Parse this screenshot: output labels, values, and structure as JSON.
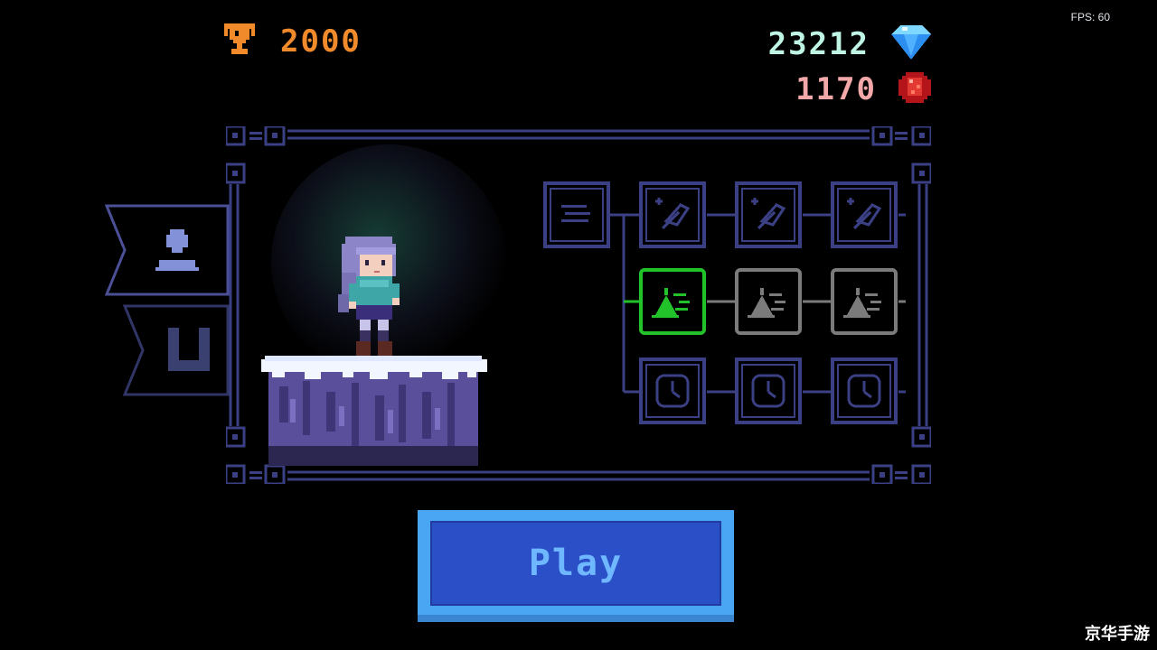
{
  "hud": {
    "fps": "FPS: 60",
    "trophy_score": "2000",
    "blue_gems": "23212",
    "red_gems": "1170"
  },
  "play_button": {
    "label": "Play"
  },
  "watermark": "京华手游",
  "icons": {
    "trophy": "trophy-icon",
    "blue_gem": "blue-diamond-icon",
    "red_gem": "red-gem-icon",
    "character_tab": "character-icon",
    "magnet_tab": "magnet-icon"
  },
  "skill_tree": {
    "rows": [
      {
        "row": "feather",
        "nodes": [
          "root-list",
          "feather-1",
          "feather-2",
          "feather-3"
        ]
      },
      {
        "row": "speed",
        "nodes": [
          "speed-1",
          "speed-2",
          "speed-3"
        ],
        "active": "speed-1"
      },
      {
        "row": "clock",
        "nodes": [
          "clock-1",
          "clock-2",
          "clock-3"
        ]
      }
    ]
  },
  "colors": {
    "frame": "#3b3f84",
    "active_node": "#22c32a",
    "inactive_node": "#7b7b7b",
    "trophy": "#f08a2b",
    "blue_gem_text": "#bff5e5",
    "red_gem_text": "#f2a8a8",
    "play_outer": "#4aa5f2",
    "play_inner": "#2a4fc7"
  }
}
